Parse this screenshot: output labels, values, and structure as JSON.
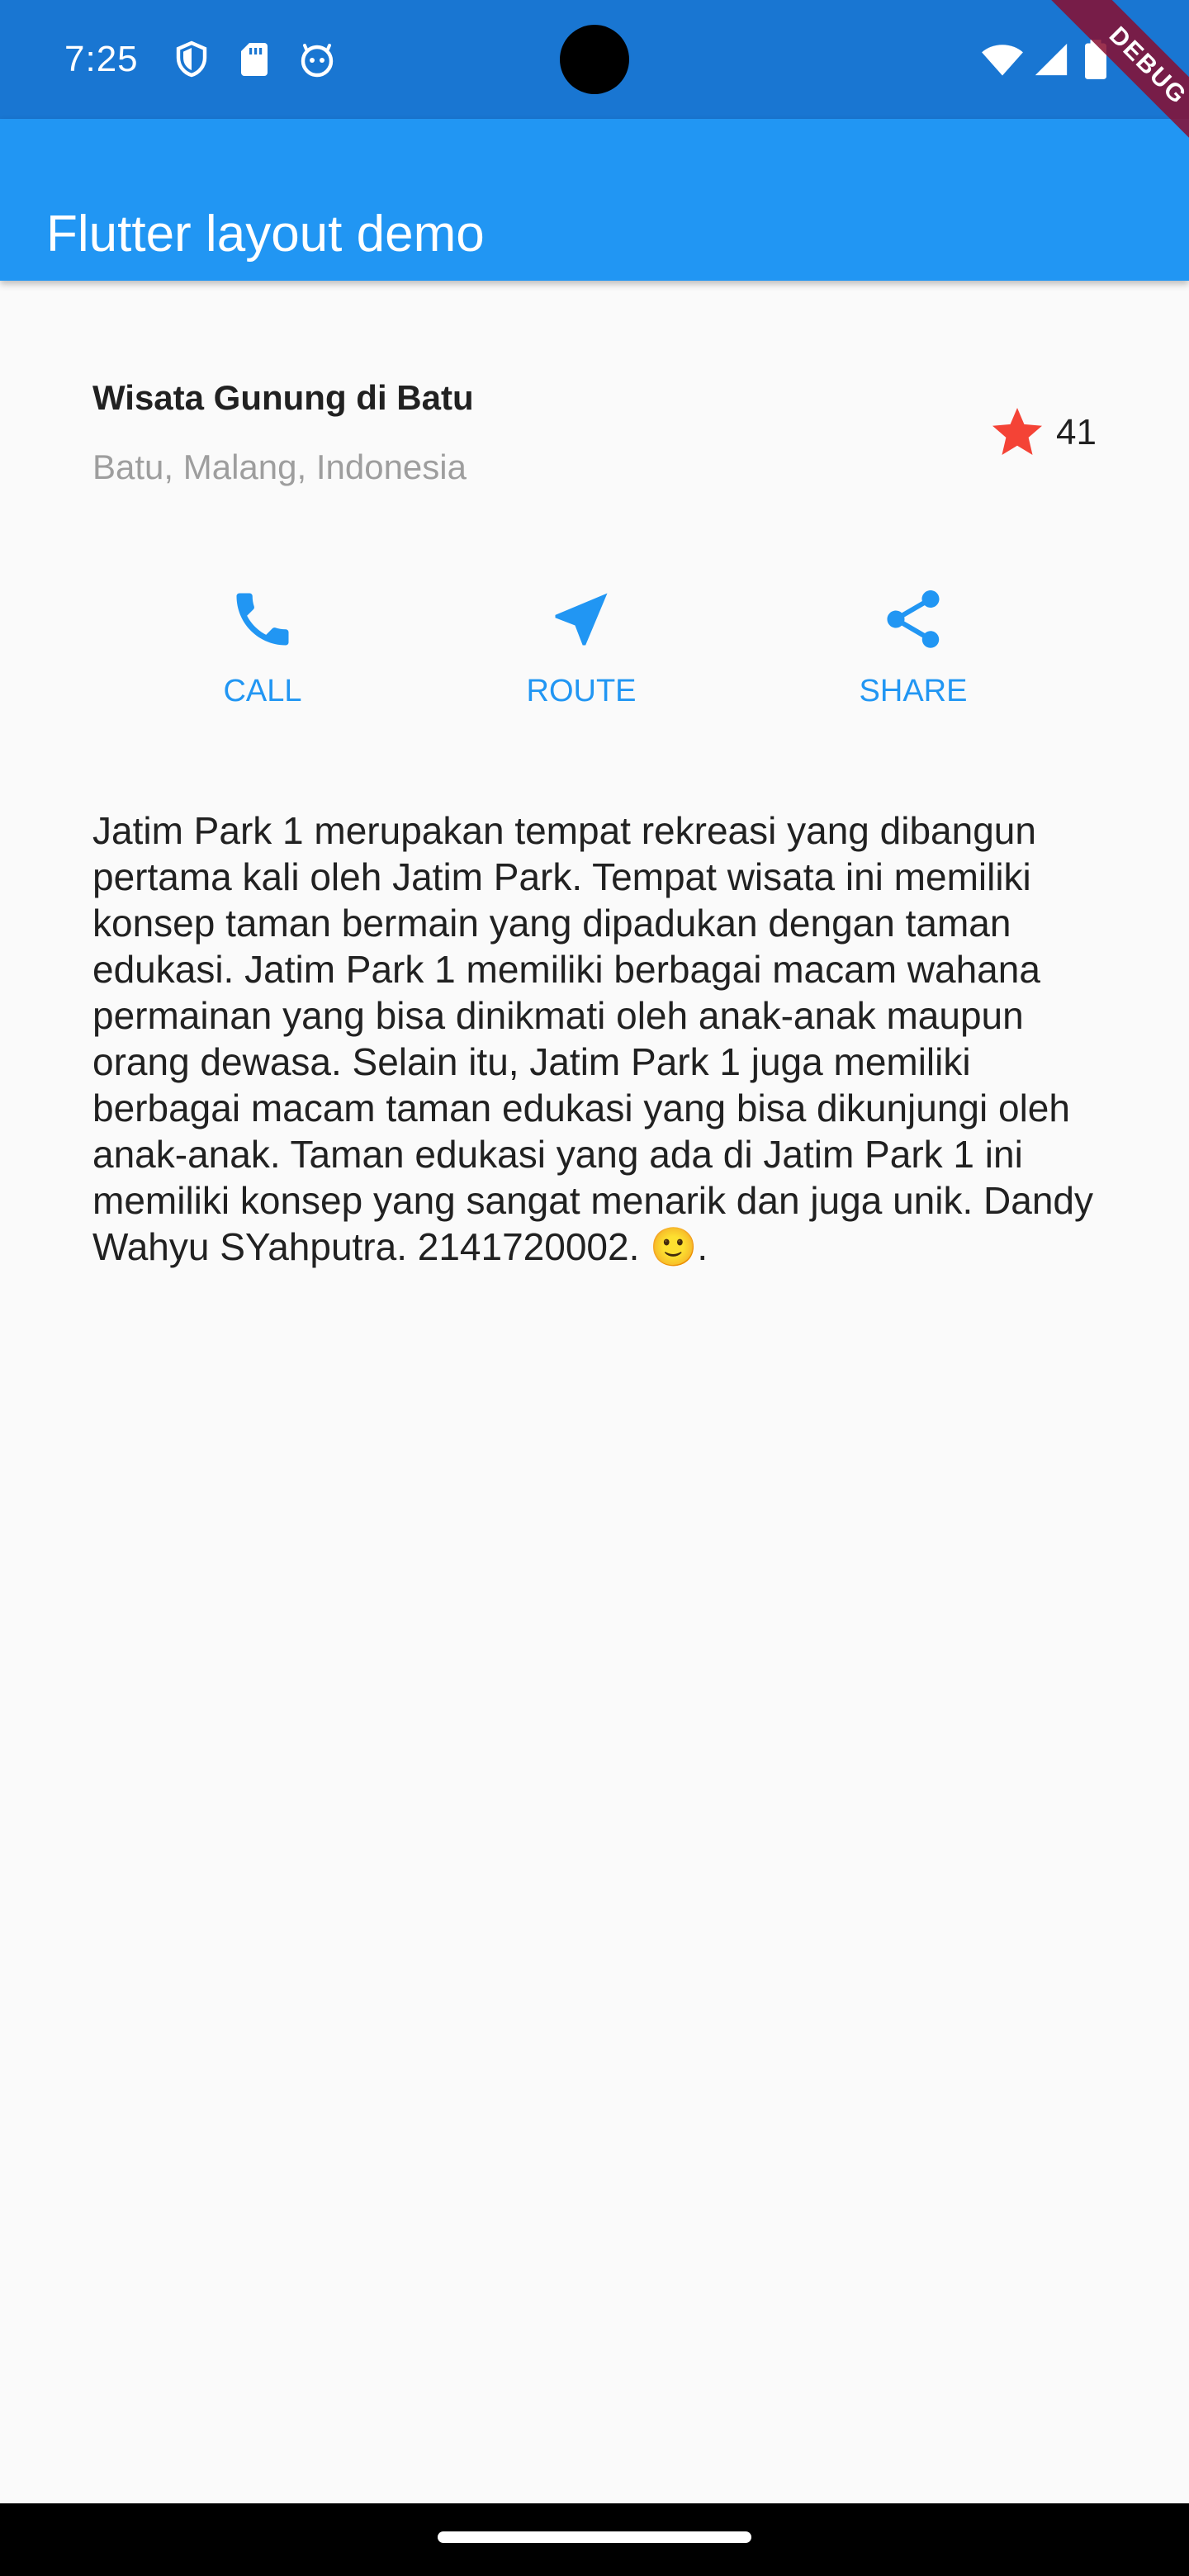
{
  "status_bar": {
    "time": "7:25",
    "background_color": "#1976d2",
    "left_icons": [
      "shield-icon",
      "sd-card-icon",
      "notification-face-icon"
    ],
    "right_icons": [
      "wifi-icon",
      "signal-icon",
      "battery-icon"
    ]
  },
  "app_bar": {
    "title": "Flutter layout demo",
    "background_color": "#2196f3"
  },
  "debug_banner": {
    "label": "DEBUG"
  },
  "title_section": {
    "name": "Wisata Gunung di Batu",
    "location": "Batu, Malang, Indonesia",
    "rating_icon": "star-icon",
    "rating_color": "#f44336",
    "rating_count": "41"
  },
  "buttons": [
    {
      "icon": "phone-icon",
      "label": "CALL"
    },
    {
      "icon": "navigation-icon",
      "label": "ROUTE"
    },
    {
      "icon": "share-icon",
      "label": "SHARE"
    }
  ],
  "accent_color": "#2196f3",
  "description": "Jatim Park 1 merupakan tempat rekreasi yang dibangun pertama kali oleh Jatim Park. Tempat wisata ini memiliki konsep taman bermain yang dipadukan dengan taman edukasi. Jatim Park 1 memiliki berbagai macam wahana permainan yang bisa dinikmati oleh anak-anak maupun orang dewasa. Selain itu, Jatim Park 1 juga memiliki berbagai macam taman edukasi yang bisa dikunjungi oleh anak-anak. Taman edukasi yang ada di Jatim Park 1 ini memiliki konsep yang sangat menarik dan juga unik. Dandy Wahyu SYahputra. 2141720002. 🙂."
}
